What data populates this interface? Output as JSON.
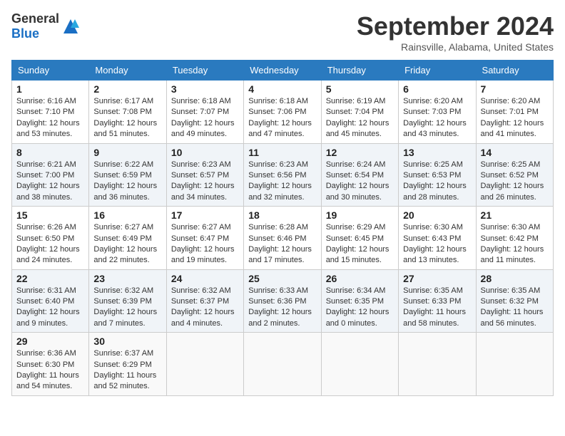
{
  "header": {
    "logo_general": "General",
    "logo_blue": "Blue",
    "month_title": "September 2024",
    "location": "Rainsville, Alabama, United States"
  },
  "weekdays": [
    "Sunday",
    "Monday",
    "Tuesday",
    "Wednesday",
    "Thursday",
    "Friday",
    "Saturday"
  ],
  "weeks": [
    [
      {
        "day": "1",
        "sunrise": "6:16 AM",
        "sunset": "7:10 PM",
        "daylight": "12 hours and 53 minutes."
      },
      {
        "day": "2",
        "sunrise": "6:17 AM",
        "sunset": "7:08 PM",
        "daylight": "12 hours and 51 minutes."
      },
      {
        "day": "3",
        "sunrise": "6:18 AM",
        "sunset": "7:07 PM",
        "daylight": "12 hours and 49 minutes."
      },
      {
        "day": "4",
        "sunrise": "6:18 AM",
        "sunset": "7:06 PM",
        "daylight": "12 hours and 47 minutes."
      },
      {
        "day": "5",
        "sunrise": "6:19 AM",
        "sunset": "7:04 PM",
        "daylight": "12 hours and 45 minutes."
      },
      {
        "day": "6",
        "sunrise": "6:20 AM",
        "sunset": "7:03 PM",
        "daylight": "12 hours and 43 minutes."
      },
      {
        "day": "7",
        "sunrise": "6:20 AM",
        "sunset": "7:01 PM",
        "daylight": "12 hours and 41 minutes."
      }
    ],
    [
      {
        "day": "8",
        "sunrise": "6:21 AM",
        "sunset": "7:00 PM",
        "daylight": "12 hours and 38 minutes."
      },
      {
        "day": "9",
        "sunrise": "6:22 AM",
        "sunset": "6:59 PM",
        "daylight": "12 hours and 36 minutes."
      },
      {
        "day": "10",
        "sunrise": "6:23 AM",
        "sunset": "6:57 PM",
        "daylight": "12 hours and 34 minutes."
      },
      {
        "day": "11",
        "sunrise": "6:23 AM",
        "sunset": "6:56 PM",
        "daylight": "12 hours and 32 minutes."
      },
      {
        "day": "12",
        "sunrise": "6:24 AM",
        "sunset": "6:54 PM",
        "daylight": "12 hours and 30 minutes."
      },
      {
        "day": "13",
        "sunrise": "6:25 AM",
        "sunset": "6:53 PM",
        "daylight": "12 hours and 28 minutes."
      },
      {
        "day": "14",
        "sunrise": "6:25 AM",
        "sunset": "6:52 PM",
        "daylight": "12 hours and 26 minutes."
      }
    ],
    [
      {
        "day": "15",
        "sunrise": "6:26 AM",
        "sunset": "6:50 PM",
        "daylight": "12 hours and 24 minutes."
      },
      {
        "day": "16",
        "sunrise": "6:27 AM",
        "sunset": "6:49 PM",
        "daylight": "12 hours and 22 minutes."
      },
      {
        "day": "17",
        "sunrise": "6:27 AM",
        "sunset": "6:47 PM",
        "daylight": "12 hours and 19 minutes."
      },
      {
        "day": "18",
        "sunrise": "6:28 AM",
        "sunset": "6:46 PM",
        "daylight": "12 hours and 17 minutes."
      },
      {
        "day": "19",
        "sunrise": "6:29 AM",
        "sunset": "6:45 PM",
        "daylight": "12 hours and 15 minutes."
      },
      {
        "day": "20",
        "sunrise": "6:30 AM",
        "sunset": "6:43 PM",
        "daylight": "12 hours and 13 minutes."
      },
      {
        "day": "21",
        "sunrise": "6:30 AM",
        "sunset": "6:42 PM",
        "daylight": "12 hours and 11 minutes."
      }
    ],
    [
      {
        "day": "22",
        "sunrise": "6:31 AM",
        "sunset": "6:40 PM",
        "daylight": "12 hours and 9 minutes."
      },
      {
        "day": "23",
        "sunrise": "6:32 AM",
        "sunset": "6:39 PM",
        "daylight": "12 hours and 7 minutes."
      },
      {
        "day": "24",
        "sunrise": "6:32 AM",
        "sunset": "6:37 PM",
        "daylight": "12 hours and 4 minutes."
      },
      {
        "day": "25",
        "sunrise": "6:33 AM",
        "sunset": "6:36 PM",
        "daylight": "12 hours and 2 minutes."
      },
      {
        "day": "26",
        "sunrise": "6:34 AM",
        "sunset": "6:35 PM",
        "daylight": "12 hours and 0 minutes."
      },
      {
        "day": "27",
        "sunrise": "6:35 AM",
        "sunset": "6:33 PM",
        "daylight": "11 hours and 58 minutes."
      },
      {
        "day": "28",
        "sunrise": "6:35 AM",
        "sunset": "6:32 PM",
        "daylight": "11 hours and 56 minutes."
      }
    ],
    [
      {
        "day": "29",
        "sunrise": "6:36 AM",
        "sunset": "6:30 PM",
        "daylight": "11 hours and 54 minutes."
      },
      {
        "day": "30",
        "sunrise": "6:37 AM",
        "sunset": "6:29 PM",
        "daylight": "11 hours and 52 minutes."
      },
      null,
      null,
      null,
      null,
      null
    ]
  ]
}
